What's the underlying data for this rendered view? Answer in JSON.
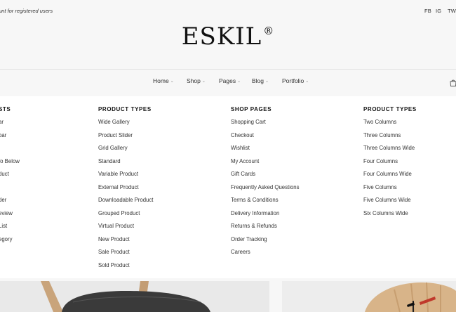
{
  "topbar": {
    "promo_text": "unt for registered users",
    "social": [
      "FB",
      "IG",
      "TW"
    ]
  },
  "logo": {
    "name": "ESKIL",
    "mark": "®"
  },
  "nav": {
    "items": [
      {
        "label": "Home"
      },
      {
        "label": "Shop"
      },
      {
        "label": "Pages"
      },
      {
        "label": "Blog"
      },
      {
        "label": "Portfolio"
      }
    ],
    "cart_icon": "shopping-bag-icon"
  },
  "mega_menu": {
    "columns": [
      {
        "title": "STS",
        "items": [
          "ar",
          "bar",
          "",
          "fo Below",
          "duct",
          "",
          "der",
          "eview",
          "List",
          "egory"
        ]
      },
      {
        "title": "PRODUCT TYPES",
        "items": [
          "Wide Gallery",
          "Product Slider",
          "Grid Gallery",
          "Standard",
          "Variable Product",
          "External Product",
          "Downloadable Product",
          "Grouped Product",
          "Virtual Product",
          "New Product",
          "Sale Product",
          "Sold Product"
        ]
      },
      {
        "title": "SHOP PAGES",
        "items": [
          "Shopping Cart",
          "Checkout",
          "Wishlist",
          "My Account",
          "Gift Cards",
          "Frequently Asked Questions",
          "Terms & Conditions",
          "Delivery Information",
          "Returns & Refunds",
          "Order Tracking",
          "Careers"
        ]
      },
      {
        "title": "PRODUCT TYPES",
        "items": [
          "Two Columns",
          "Three Columns",
          "Three Columns Wide",
          "Four Columns",
          "Four Columns Wide",
          "Five Columns",
          "Five Columns Wide",
          "Six Columns Wide"
        ]
      }
    ]
  },
  "colors": {
    "background": "#f7f7f7",
    "menu_bg": "#ffffff",
    "text": "#333333",
    "heading": "#111111",
    "stool_seat": "#3a3a3a",
    "wood": "#c8a27a"
  }
}
